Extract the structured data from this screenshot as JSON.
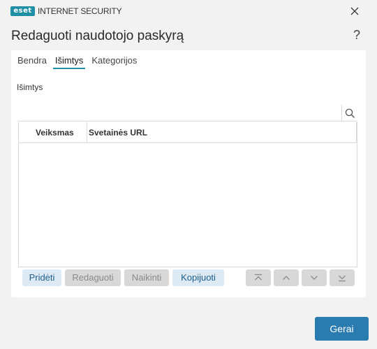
{
  "window": {
    "logo_text": "eset",
    "app_name": "INTERNET SECURITY",
    "dialog_title": "Redaguoti naudotojo paskyrą",
    "help_label": "?"
  },
  "tabs": [
    {
      "label": "Bendra",
      "active": false
    },
    {
      "label": "Išimtys",
      "active": true
    },
    {
      "label": "Kategorijos",
      "active": false
    }
  ],
  "section": {
    "label": "Išimtys"
  },
  "search": {
    "value": "",
    "placeholder": ""
  },
  "table": {
    "columns": [
      "Veiksmas",
      "Svetainės URL"
    ],
    "rows": []
  },
  "toolbar": {
    "add_label": "Pridėti",
    "edit_label": "Redaguoti",
    "remove_label": "Naikinti",
    "copy_label": "Kopijuoti"
  },
  "footer": {
    "ok_label": "Gerai"
  },
  "colors": {
    "accent": "#1f8fa6",
    "primary_button": "#2a7cb0",
    "enabled_button_bg": "#dde9f3",
    "disabled_button_bg": "#d8d8d8"
  }
}
